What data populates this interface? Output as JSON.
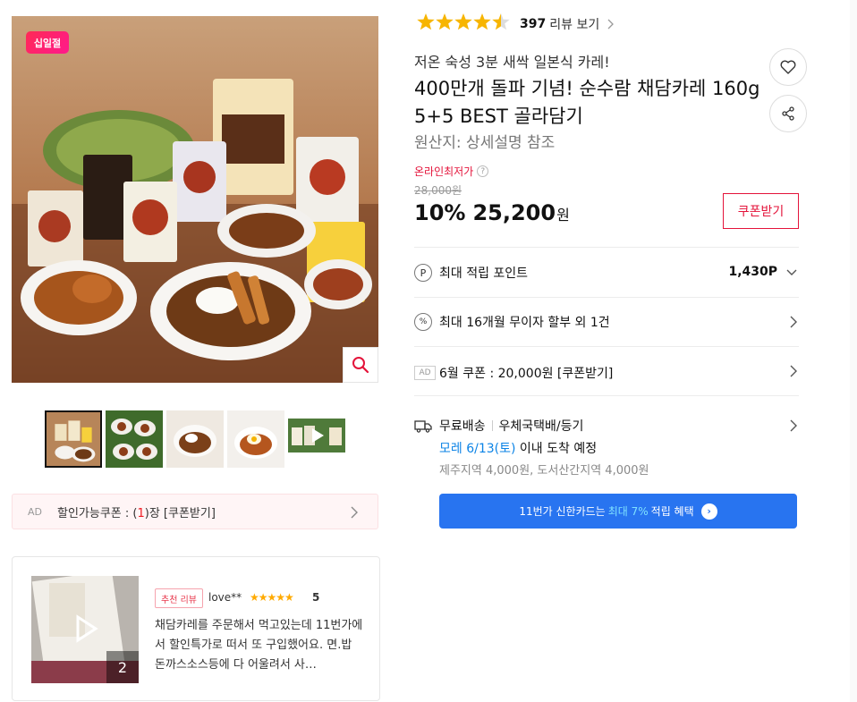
{
  "gallery": {
    "badge": "십일절",
    "zoom_icon": "magnifier-icon",
    "thumbnails": [
      "thumb-1",
      "thumb-2",
      "thumb-3",
      "thumb-4",
      "thumb-5-video"
    ]
  },
  "ad_coupon": {
    "ad_label": "AD",
    "text_before": "할인가능쿠폰 : (",
    "count": "1",
    "text_after": ")장 [쿠폰받기]"
  },
  "review": {
    "photo_count": "2",
    "tag": "추천 리뷰",
    "user": "love**",
    "stars": "★★★★★",
    "score": "5",
    "body": "채담카레를 주문해서 먹고있는데 11번가에서 할인특가로 떠서 또 구입했어요. 면.밥 돈까스소스등에 다 어울려서 사…"
  },
  "product": {
    "rating_stars": "★★★★★",
    "rating_value": 4.5,
    "review_count": "397",
    "review_link": "리뷰 보기",
    "subtitle": "저온 숙성 3분 새싹 일본식 카레!",
    "title": "400만개 돌파 기념! 순수람 채담카레 160g 5+5 BEST 골라담기",
    "origin": "원산지: 상세설명 참조",
    "online_lowest": "온라인최저가",
    "original_price": "28,000원",
    "discount": "10%",
    "price": "25,200",
    "won": "원",
    "coupon_button": "쿠폰받기"
  },
  "benefits": {
    "points_label": "최대 적립 포인트",
    "points_value": "1,430P",
    "installment": "최대 16개월 무이자 할부 외 1건",
    "ad_label": "AD",
    "june_coupon": "6월 쿠폰 : 20,000원 [쿠폰받기]",
    "shipping_free": "무료배송",
    "shipping_method": "우체국택배/등기",
    "delivery_date": "모레 6/13(토)",
    "delivery_suffix": " 이내 도착 예정",
    "extra_fee": "제주지역 4,000원, 도서산간지역 4,000원"
  },
  "card_banner": {
    "text_before": "11번가 신한카드는",
    "highlight": "최대 7%",
    "text_after": "적립 혜택"
  },
  "colors": {
    "accent_red": "#e4133a",
    "link_blue": "#0b83e6",
    "banner_blue": "#2874f0",
    "star_gold": "#f7b500"
  }
}
